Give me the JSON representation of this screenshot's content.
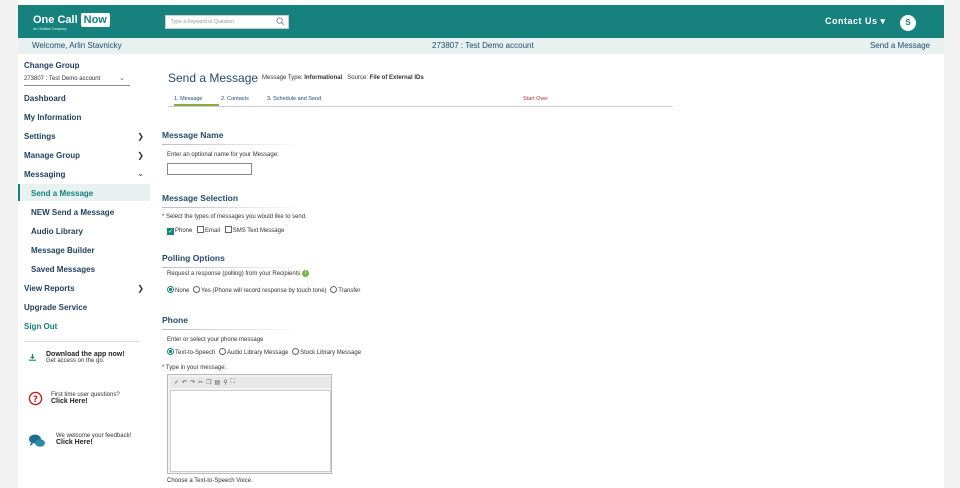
{
  "header": {
    "logo_text": "One Call",
    "logo_now": "Now",
    "logo_subtitle": "An Onlabor Company",
    "search_placeholder": "Type a Keyword or Question",
    "contact_label": "Contact Us ▾",
    "avatar_initial": "S"
  },
  "subbar": {
    "welcome": "Welcome, Arlin Stavnicky",
    "account": "273807 : Test Demo account",
    "breadcrumb": "Send a Message"
  },
  "sidebar": {
    "change_group": "Change Group",
    "group_select": "273807 : Test Demo account",
    "items": [
      {
        "label": "Dashboard"
      },
      {
        "label": "My Information"
      },
      {
        "label": "Settings"
      },
      {
        "label": "Manage Group"
      },
      {
        "label": "Messaging"
      },
      {
        "label": "Send a Message"
      },
      {
        "label": "NEW Send a Message"
      },
      {
        "label": "Audio Library"
      },
      {
        "label": "Message Builder"
      },
      {
        "label": "Saved Messages"
      },
      {
        "label": "View Reports"
      },
      {
        "label": "Upgrade Service"
      },
      {
        "label": "Sign Out"
      }
    ],
    "promo_app_title": "Download the app now!",
    "promo_app_sub": "Get access on the go.",
    "promo_faq_title": "First time user questions?",
    "promo_faq_link": "Click Here!",
    "promo_feedback_title": "We welcome your feedback!",
    "promo_feedback_link": "Click Here!"
  },
  "main": {
    "title": "Send a Message",
    "message_type_label": "Message Type:",
    "message_type_value": "Informational",
    "source_label": "Source:",
    "source_value": "File of External IDs",
    "steps": [
      "1. Message",
      "2. Contacts",
      "3. Schedule and Send"
    ],
    "start_over": "Start Over",
    "sec_name": "Message Name",
    "name_prompt": "Enter an optional name for your Message:",
    "sec_selection": "Message Selection",
    "selection_prompt": "Select the types of messages you would like to send.",
    "opt_phone": "Phone",
    "opt_email": "Email",
    "opt_sms": "SMS Text Message",
    "sec_polling": "Polling Options",
    "polling_prompt": "Request a response (polling) from your Recipients",
    "poll_none": "None",
    "poll_yes": "Yes (Phone will record response by touch tone)",
    "poll_transfer": "Transfer",
    "sec_phone": "Phone",
    "phone_prompt": "Enter or select your phone message",
    "phone_tts": "Text-to-Speech",
    "phone_audio": "Audio Library Message",
    "phone_stock": "Stock Library Message",
    "type_prompt": "Type in your message:",
    "voice_prompt": "Choose a Text-to-Speech Voice."
  }
}
